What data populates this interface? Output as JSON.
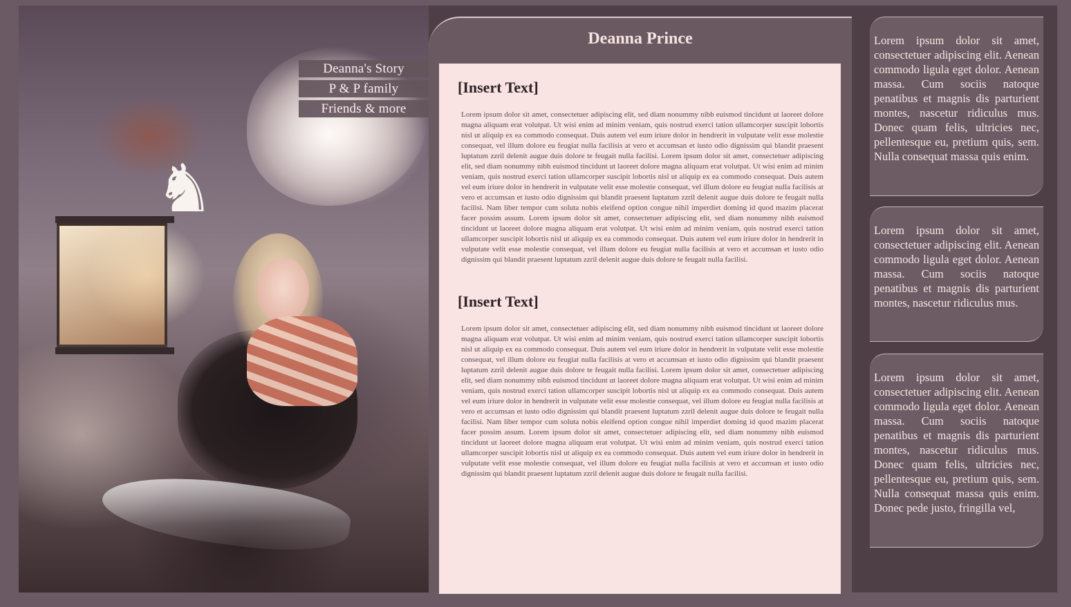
{
  "page": {
    "title": "Deanna Prince"
  },
  "nav": {
    "items": [
      {
        "label": "Deanna's Story"
      },
      {
        "label": "P & P family"
      },
      {
        "label": "Friends & more"
      }
    ]
  },
  "sections": [
    {
      "heading": "[Insert Text]",
      "body": "Lorem ipsum dolor sit amet, consectetuer adipiscing elit, sed diam nonummy nibh euismod tincidunt ut laoreet dolore magna aliquam erat volutpat. Ut wisi enim ad minim veniam, quis nostrud exerci tation ullamcorper suscipit lobortis nisl ut aliquip ex ea commodo consequat. Duis autem vel eum iriure dolor in hendrerit in vulputate velit esse molestie consequat, vel illum dolore eu feugiat nulla facilisis at vero et accumsan et iusto odio dignissim qui blandit praesent luptatum zzril delenit augue duis dolore te feugait nulla facilisi. Lorem ipsum dolor sit amet, consectetuer adipiscing elit, sed diam nonummy nibh euismod tincidunt ut laoreet dolore magna aliquam erat volutpat. Ut wisi enim ad minim veniam, quis nostrud exerci tation ullamcorper suscipit lobortis nisl ut aliquip ex ea commodo consequat. Duis autem vel eum iriure dolor in hendrerit in vulputate velit esse molestie consequat, vel illum dolore eu feugiat nulla facilisis at vero et accumsan et iusto odio dignissim qui blandit praesent luptatum zzril delenit augue duis dolore te feugait nulla facilisi. Nam liber tempor cum soluta nobis eleifend option congue nihil imperdiet doming id quod mazim placerat facer possim assum. Lorem ipsum dolor sit amet, consectetuer adipiscing elit, sed diam nonummy nibh euismod tincidunt ut laoreet dolore magna aliquam erat volutpat. Ut wisi enim ad minim veniam, quis nostrud exerci tation ullamcorper suscipit lobortis nisl ut aliquip ex ea commodo consequat. Duis autem vel eum iriure dolor in hendrerit in vulputate velit esse molestie consequat, vel illum dolore eu feugiat nulla facilisis at vero et accumsan et iusto odio dignissim qui blandit praesent luptatum zzril delenit augue duis dolore te feugait nulla facilisi."
    },
    {
      "heading": "[Insert Text]",
      "body": "Lorem ipsum dolor sit amet, consectetuer adipiscing elit, sed diam nonummy nibh euismod tincidunt ut laoreet dolore magna aliquam erat volutpat. Ut wisi enim ad minim veniam, quis nostrud exerci tation ullamcorper suscipit lobortis nisl ut aliquip ex ea commodo consequat. Duis autem vel eum iriure dolor in hendrerit in vulputate velit esse molestie consequat, vel illum dolore eu feugiat nulla facilisis at vero et accumsan et iusto odio dignissim qui blandit praesent luptatum zzril delenit augue duis dolore te feugait nulla facilisi. Lorem ipsum dolor sit amet, consectetuer adipiscing elit, sed diam nonummy nibh euismod tincidunt ut laoreet dolore magna aliquam erat volutpat. Ut wisi enim ad minim veniam, quis nostrud exerci tation ullamcorper suscipit lobortis nisl ut aliquip ex ea commodo consequat. Duis autem vel eum iriure dolor in hendrerit in vulputate velit esse molestie consequat, vel illum dolore eu feugiat nulla facilisis at vero et accumsan et iusto odio dignissim qui blandit praesent luptatum zzril delenit augue duis dolore te feugait nulla facilisi. Nam liber tempor cum soluta nobis eleifend option congue nihil imperdiet doming id quod mazim placerat facer possim assum. Lorem ipsum dolor sit amet, consectetuer adipiscing elit, sed diam nonummy nibh euismod tincidunt ut laoreet dolore magna aliquam erat volutpat. Ut wisi enim ad minim veniam, quis nostrud exerci tation ullamcorper suscipit lobortis nisl ut aliquip ex ea commodo consequat. Duis autem vel eum iriure dolor in hendrerit in vulputate velit esse molestie consequat, vel illum dolore eu feugiat nulla facilisis at vero et accumsan et iusto odio dignissim qui blandit praesent luptatum zzril delenit augue duis dolore te feugait nulla facilisi."
    }
  ],
  "sidebar": {
    "boxes": [
      {
        "text": "Lorem ipsum dolor sit amet, consectetuer adipiscing elit. Aenean commodo ligula eget dolor. Aenean massa. Cum sociis natoque penatibus et magnis dis parturient montes, nascetur ridiculus mus. Donec quam felis, ultricies nec, pellentesque eu, pretium quis, sem. Nulla consequat massa quis enim."
      },
      {
        "text": "Lorem ipsum dolor sit amet, consectetuer adipiscing elit. Aenean commodo ligula eget dolor. Aenean massa. Cum sociis natoque penatibus et magnis dis parturient montes, nascetur ridiculus mus."
      },
      {
        "text": "Lorem ipsum dolor sit amet, consectetuer adipiscing elit. Aenean commodo ligula eget dolor. Aenean massa. Cum sociis natoque penatibus et magnis dis parturient montes, nascetur ridiculus mus. Donec quam felis, ultricies nec, pellentesque eu, pretium quis, sem. Nulla consequat massa quis enim. Donec pede justo, fringilla vel,"
      }
    ]
  },
  "art": {
    "icons": [
      "stag-icon",
      "lily-icon",
      "lantern-icon"
    ]
  },
  "colors": {
    "background": "#6b5a63",
    "frame": "#4e3f47",
    "panel": "#6b5961",
    "content_bg": "#f9e3e3",
    "title_text": "#f7e5e4",
    "body_text": "#5a4d52"
  }
}
